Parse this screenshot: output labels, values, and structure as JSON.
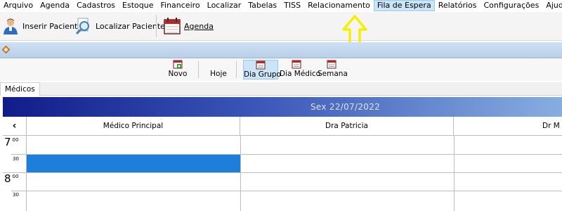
{
  "menu": [
    "Arquivo",
    "Agenda",
    "Cadastros",
    "Estoque",
    "Financeiro",
    "Localizar",
    "Tabelas",
    "TISS",
    "Relacionamento",
    "Fila de Espera",
    "Relatórios",
    "Configurações",
    "Ajuda"
  ],
  "menu_highlight": "Fila de Espera",
  "toolbar": {
    "insert_patient": "Inserir Paciente",
    "find_patient": "Localizar Paciente",
    "agenda": "Agenda"
  },
  "subtoolbar": {
    "novo": "Novo",
    "hoje": "Hoje",
    "dia_grupo": "Dia Grupo",
    "dia_medico": "Dia Médico",
    "semana": "Semana"
  },
  "tab": "Médicos",
  "date": "Sex 22/07/2022",
  "scroll_left": "‹",
  "columns": [
    "Médico Principal",
    "Dra Patricia",
    "Dr M"
  ],
  "times": {
    "h7": "7",
    "h7_min": "00",
    "h7_half": "30",
    "h8": "8",
    "h8_min": "00",
    "h8_half": "30"
  },
  "colors": {
    "date_band_start": "#101c8a",
    "date_band_end": "#87aee0",
    "selected_slot": "#1e7fdb",
    "annotation_arrow": "#f5f000"
  }
}
